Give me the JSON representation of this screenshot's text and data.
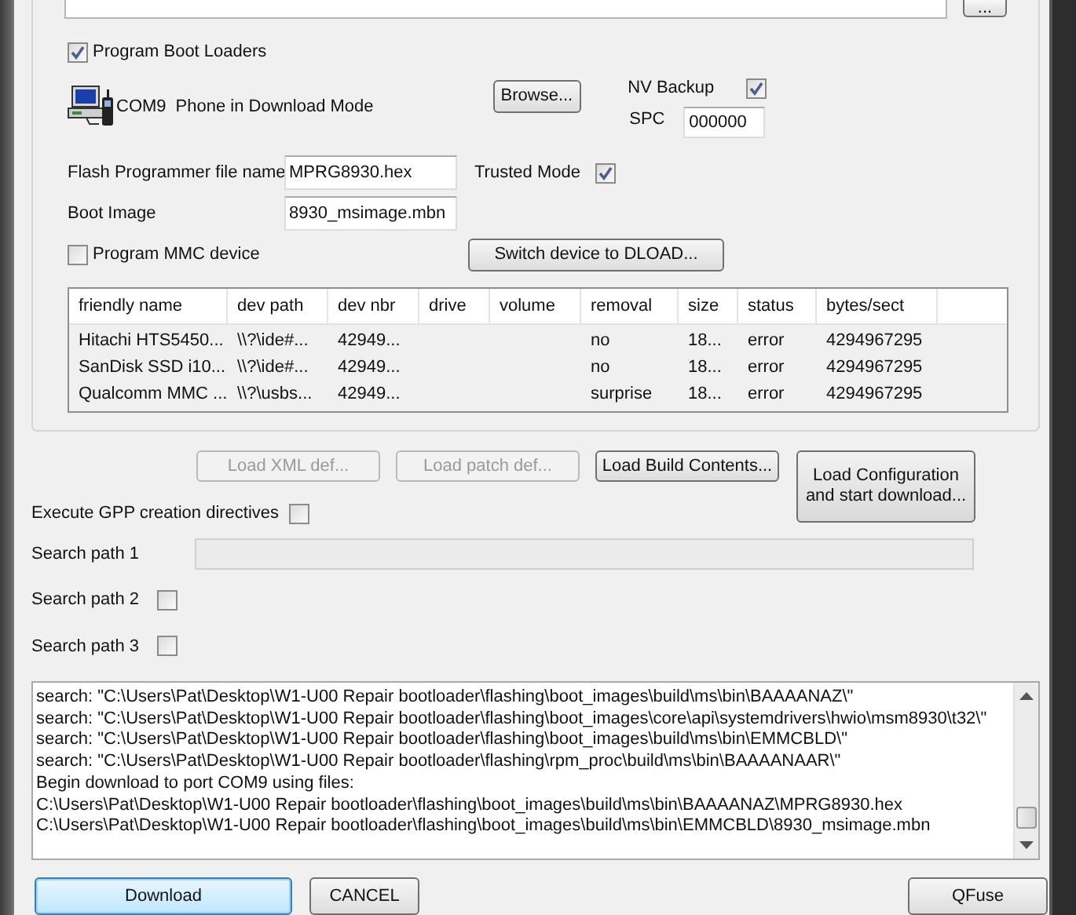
{
  "path_browse_button": "...",
  "program_boot_loaders": {
    "label": "Program Boot Loaders",
    "checked": true
  },
  "port": {
    "name": "COM9",
    "status": "Phone in Download Mode"
  },
  "browse_button": "Browse...",
  "nv_backup": {
    "label": "NV Backup",
    "checked": true
  },
  "spc": {
    "label": "SPC",
    "value": "000000"
  },
  "flash_programmer": {
    "label": "Flash Programmer file name",
    "value": "MPRG8930.hex"
  },
  "trusted_mode": {
    "label": "Trusted Mode",
    "checked": true
  },
  "boot_image": {
    "label": "Boot Image",
    "value": "8930_msimage.mbn"
  },
  "program_mmc": {
    "label": "Program MMC device",
    "checked": false
  },
  "switch_button": "Switch device to DLOAD...",
  "devices": {
    "columns": [
      "friendly name",
      "dev path",
      "dev nbr",
      "drive",
      "volume",
      "removal",
      "size",
      "status",
      "bytes/sect"
    ],
    "rows": [
      [
        "Hitachi HTS5450...",
        "\\\\?\\ide#...",
        "42949...",
        null,
        null,
        "no",
        "18...",
        "error",
        "4294967295"
      ],
      [
        "SanDisk SSD i10...",
        "\\\\?\\ide#...",
        "42949...",
        null,
        null,
        "no",
        "18...",
        "error",
        "4294967295"
      ],
      [
        "Qualcomm MMC ...",
        "\\\\?\\usbs...",
        "42949...",
        null,
        null,
        "surprise",
        "18...",
        "error",
        "4294967295"
      ]
    ]
  },
  "load_buttons": [
    {
      "label": "Load XML def...",
      "disabled": true
    },
    {
      "label": "Load patch def...",
      "disabled": true
    },
    {
      "label": "Load Build Contents...",
      "disabled": false
    }
  ],
  "load_configuration_button": [
    "Load Configuration",
    "and start download..."
  ],
  "execute_gpp": {
    "label": "Execute GPP creation directives",
    "checked": false
  },
  "search_paths": [
    {
      "label": "Search path 1",
      "kind": "field",
      "disabled": true
    },
    {
      "label": "Search path 2",
      "kind": "checkbox",
      "checked": false
    },
    {
      "label": "Search path 3",
      "kind": "checkbox",
      "checked": false
    }
  ],
  "log": [
    "search: \"C:\\Users\\Pat\\Desktop\\W1-U00 Repair bootloader\\flashing\\boot_images\\build\\ms\\bin\\BAAAANAZ\\\"",
    "search: \"C:\\Users\\Pat\\Desktop\\W1-U00 Repair bootloader\\flashing\\boot_images\\core\\api\\systemdrivers\\hwio\\msm8930\\t32\\\"",
    "search: \"C:\\Users\\Pat\\Desktop\\W1-U00 Repair bootloader\\flashing\\boot_images\\build\\ms\\bin\\EMMCBLD\\\"",
    "search: \"C:\\Users\\Pat\\Desktop\\W1-U00 Repair bootloader\\flashing\\rpm_proc\\build\\ms\\bin\\BAAAANAAR\\\"",
    "Begin download to port COM9 using files:",
    "C:\\Users\\Pat\\Desktop\\W1-U00 Repair bootloader\\flashing\\boot_images\\build\\ms\\bin\\BAAAANAZ\\MPRG8930.hex",
    "C:\\Users\\Pat\\Desktop\\W1-U00 Repair bootloader\\flashing\\boot_images\\build\\ms\\bin\\EMMCBLD\\8930_msimage.mbn"
  ],
  "download_button": {
    "label": "Download",
    "default": true
  },
  "cancel_button": {
    "label": "CANCEL",
    "default": false
  },
  "qfuse_button": {
    "label": "QFuse",
    "default": false
  }
}
